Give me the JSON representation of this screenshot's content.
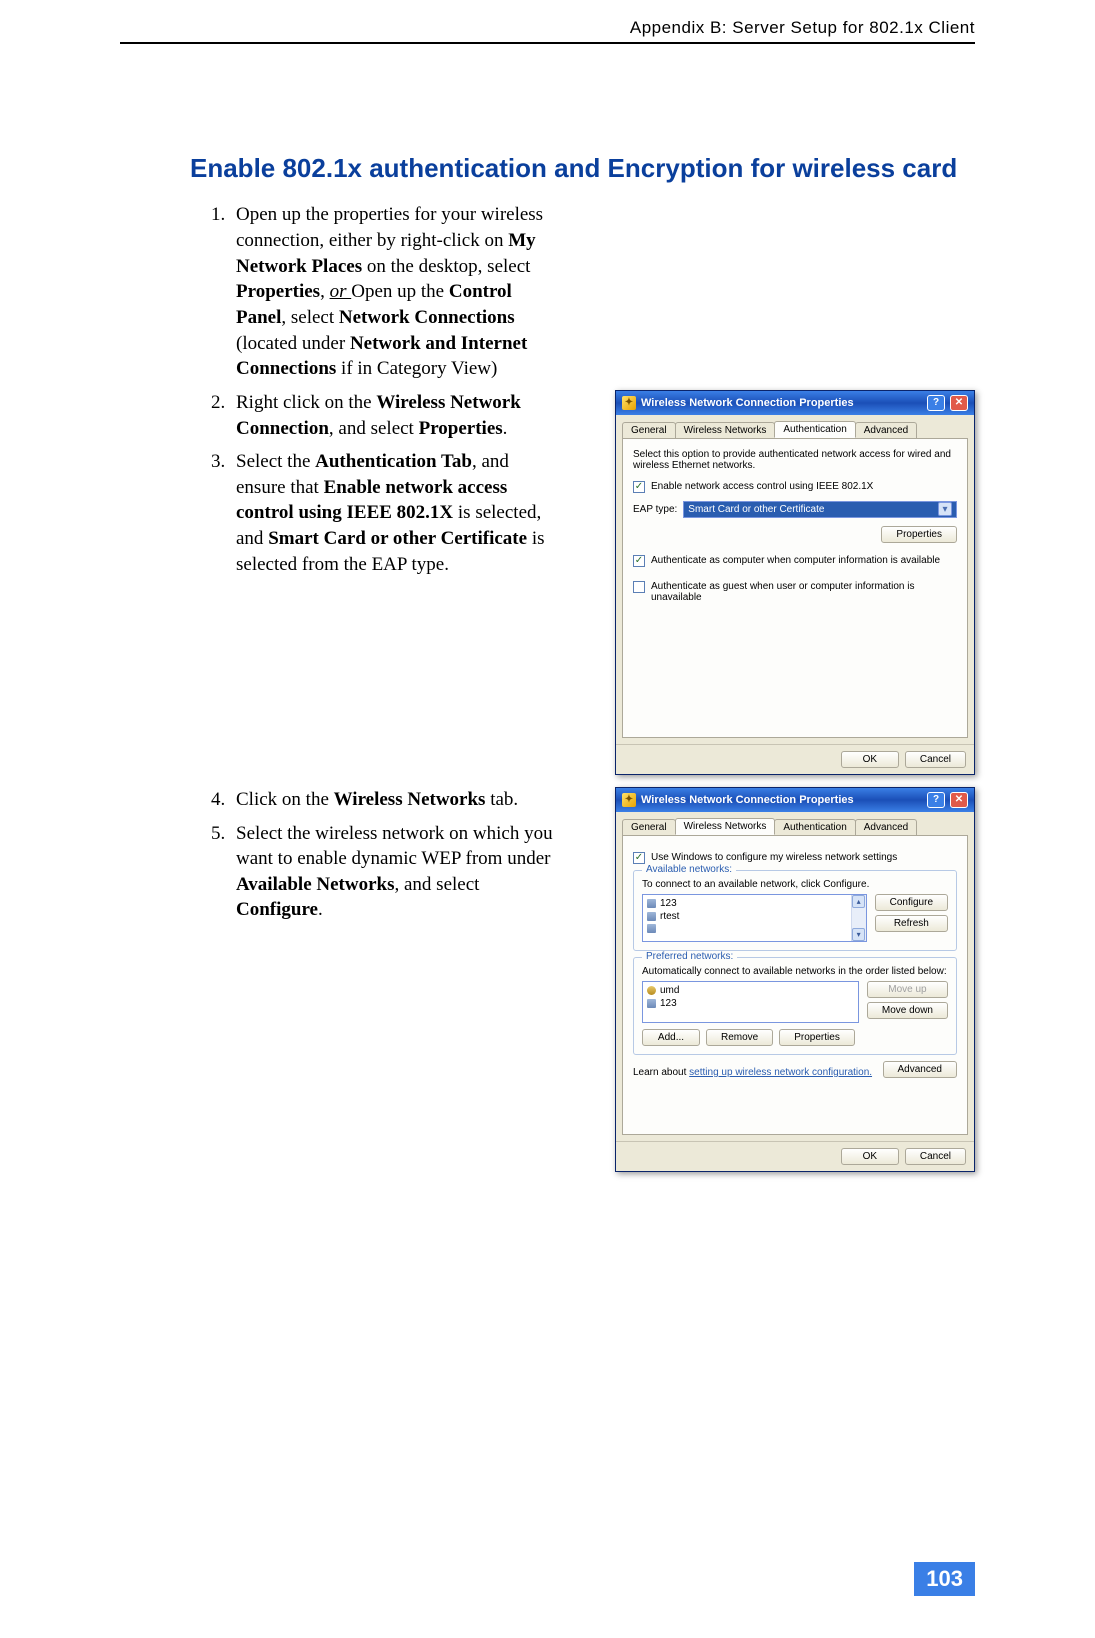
{
  "header": {
    "title": "Appendix B: Server Setup for 802.1x Client"
  },
  "section": {
    "title": "Enable 802.1x authentication and Encryption for wireless card"
  },
  "steps": {
    "s1a": "Open up the properties for your wireless connection, either by right-click on ",
    "s1b": "My Network Places",
    "s1c": " on the desktop, select ",
    "s1d": "Properties",
    "s1e": ", ",
    "s1f": "or ",
    "s1g": "Open up the ",
    "s1h": "Control Panel",
    "s1i": ", select ",
    "s1j": "Network Connections",
    "s1k": " (located under ",
    "s1l": "Network and Internet Connections",
    "s1m": " if in Category View)",
    "s2a": "Right click on the ",
    "s2b": "Wireless Network Connection",
    "s2c": ", and select ",
    "s2d": "Properties",
    "s2e": ".",
    "s3a": "Select the ",
    "s3b": "Authentication Tab",
    "s3c": ", and ensure that ",
    "s3d": "Enable network access control using IEEE 802.1X",
    "s3e": " is selected, and ",
    "s3f": "Smart Card or other Certificate",
    "s3g": " is selected from the EAP type.",
    "s4a": "Click on the ",
    "s4b": "Wireless Networks",
    "s4c": " tab.",
    "s5a": "Select the wireless network on which you want to enable dynamic WEP from under ",
    "s5b": "Available Networks",
    "s5c": ", and select ",
    "s5d": "Configure",
    "s5e": "."
  },
  "dialog1": {
    "title": "Wireless Network Connection Properties",
    "tabs": {
      "general": "General",
      "wireless": "Wireless Networks",
      "auth": "Authentication",
      "advanced": "Advanced"
    },
    "desc": "Select this option to provide authenticated network access for wired and wireless Ethernet networks.",
    "chk_enable": "Enable network access control using IEEE 802.1X",
    "eap_label": "EAP type:",
    "eap_value": "Smart Card or other Certificate",
    "btn_props": "Properties",
    "chk_computer": "Authenticate as computer when computer information is available",
    "chk_guest": "Authenticate as guest when user or computer information is unavailable",
    "btn_ok": "OK",
    "btn_cancel": "Cancel"
  },
  "dialog2": {
    "title": "Wireless Network Connection Properties",
    "tabs": {
      "general": "General",
      "wireless": "Wireless Networks",
      "auth": "Authentication",
      "advanced": "Advanced"
    },
    "chk_windows": "Use Windows to configure my wireless network settings",
    "group_avail": "Available networks:",
    "avail_desc": "To connect to an available network, click Configure.",
    "avail_items": {
      "a1": "123",
      "a2": "rtest"
    },
    "btn_configure": "Configure",
    "btn_refresh": "Refresh",
    "group_pref": "Preferred networks:",
    "pref_desc": "Automatically connect to available networks in the order listed below:",
    "pref_items": {
      "p1": "umd",
      "p2": "123"
    },
    "btn_moveup": "Move up",
    "btn_movedown": "Move down",
    "btn_add": "Add...",
    "btn_remove": "Remove",
    "btn_props": "Properties",
    "learn1": "Learn about ",
    "learn2": "setting up wireless network configuration.",
    "btn_advanced": "Advanced",
    "btn_ok": "OK",
    "btn_cancel": "Cancel"
  },
  "page_number": "103"
}
